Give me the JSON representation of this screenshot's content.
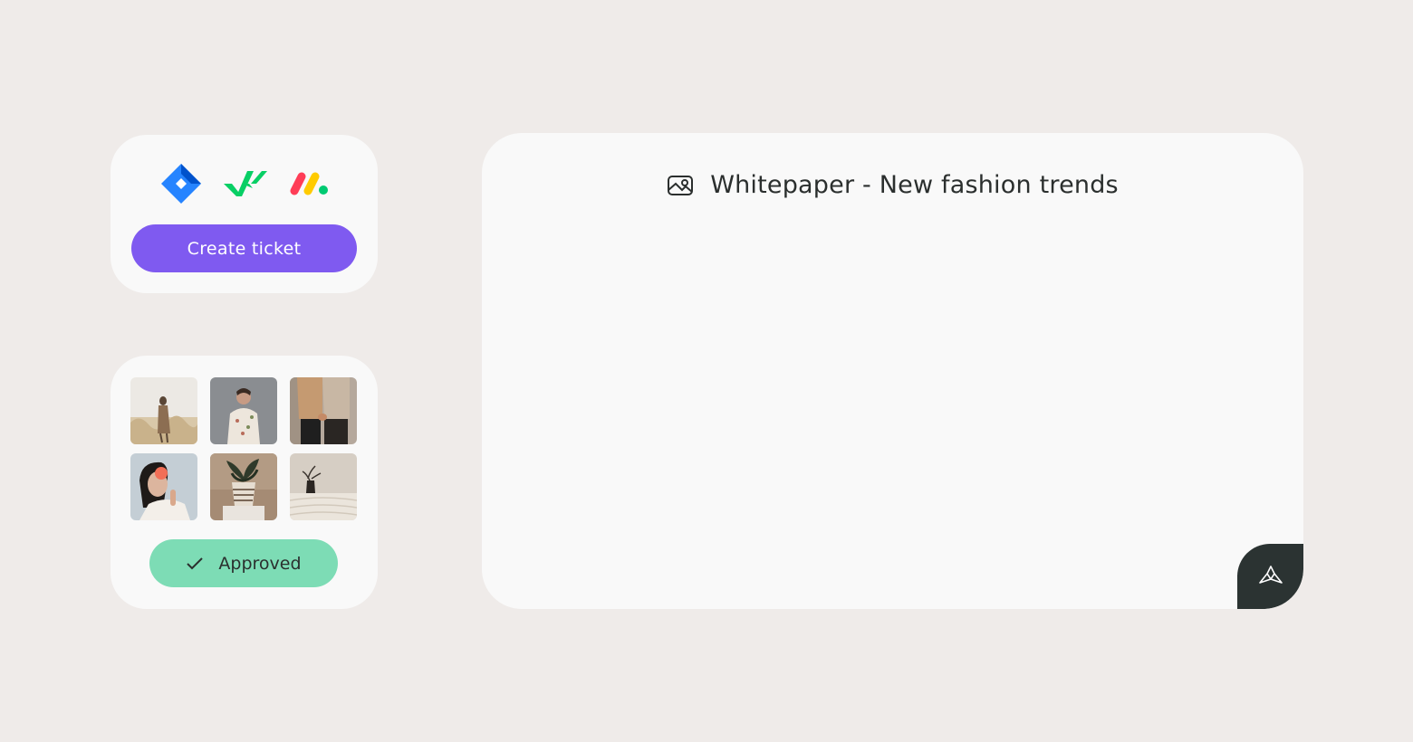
{
  "ticket_card": {
    "logos": [
      "jira-logo-icon",
      "wrike-logo-icon",
      "monday-logo-icon"
    ],
    "create_label": "Create ticket",
    "accent": "#7f5af0"
  },
  "gallery": {
    "thumbnails": [
      "woman-in-wheat-field-photo",
      "woman-in-floral-dress-photo",
      "couple-holding-hands-photo",
      "woman-with-flower-photo",
      "potted-plant-photo",
      "vase-on-bed-photo"
    ],
    "approved_label": "Approved",
    "status_color": "#7ddcb5"
  },
  "document": {
    "icon": "image-icon",
    "title": "Whitepaper - New fashion trends"
  },
  "corner_action": {
    "icon": "brand-logo-icon",
    "color": "#2b3332"
  }
}
